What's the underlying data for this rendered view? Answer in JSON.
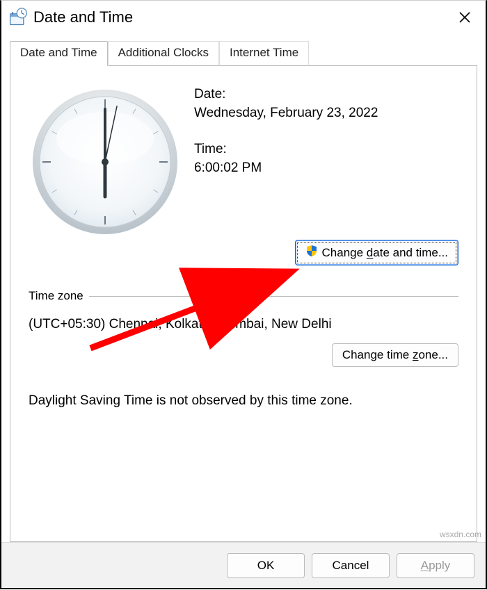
{
  "window": {
    "title": "Date and Time"
  },
  "tabs": {
    "t0": "Date and Time",
    "t1": "Additional Clocks",
    "t2": "Internet Time"
  },
  "panel": {
    "date_label": "Date:",
    "date_value": "Wednesday, February 23, 2022",
    "time_label": "Time:",
    "time_value": "6:00:02 PM",
    "change_dt_prefix": "Change ",
    "change_dt_key": "d",
    "change_dt_suffix": "ate and time...",
    "timezone_label": "Time zone",
    "timezone_value": "(UTC+05:30) Chennai, Kolkata, Mumbai, New Delhi",
    "change_tz_prefix": "Change time ",
    "change_tz_key": "z",
    "change_tz_suffix": "one...",
    "dst_note": "Daylight Saving Time is not observed by this time zone."
  },
  "footer": {
    "ok": "OK",
    "cancel": "Cancel",
    "apply_key": "A",
    "apply_suffix": "pply"
  },
  "clock": {
    "hour": 6,
    "minute": 0,
    "second": 2
  },
  "watermark": "wsxdn.com"
}
